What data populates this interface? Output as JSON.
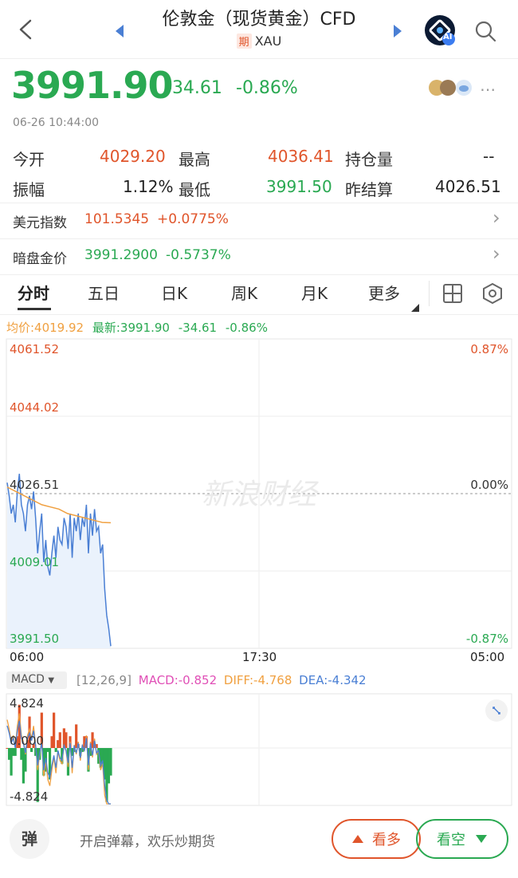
{
  "header": {
    "title": "伦敦金（现货黄金）CFD",
    "badge": "期",
    "symbol": "XAU",
    "ai_label": "AI"
  },
  "quote": {
    "price": "3991.90",
    "change": "-34.61",
    "change_pct": "-0.86%",
    "time": "06-26 10:44:00"
  },
  "stats": {
    "open_label": "今开",
    "open": "4029.20",
    "high_label": "最高",
    "high": "4036.41",
    "oi_label": "持仓量",
    "oi": "--",
    "amp_label": "振幅",
    "amp": "1.12%",
    "low_label": "最低",
    "low": "3991.50",
    "settle_label": "昨结算",
    "settle": "4026.51"
  },
  "related": [
    {
      "label": "美元指数",
      "value": "101.5345",
      "change": "+0.0775%"
    },
    {
      "label": "暗盘金价",
      "value": "3991.2900",
      "change": "-0.5737%"
    }
  ],
  "tabs": [
    "分时",
    "五日",
    "日K",
    "周K",
    "月K",
    "更多"
  ],
  "chart_legend": {
    "avg": "均价:4019.92",
    "latest": "最新:3991.90",
    "chg": "-34.61",
    "pct": "-0.86%"
  },
  "watermark": "新浪财经",
  "colors": {
    "up": "#e0552b",
    "down": "#2aa952",
    "line": "#4a7fd4",
    "avg": "#f0a040",
    "macd_pink": "#e04fb6",
    "diff": "#f0a040",
    "dea": "#4a7fd4"
  },
  "chart_data": [
    {
      "type": "line",
      "x_ticks": [
        "06:00",
        "17:30",
        "05:00"
      ],
      "y_ticks_left": [
        "4061.52",
        "4044.02",
        "4026.51",
        "4009.01",
        "3991.50"
      ],
      "y_ticks_right": [
        "0.87%",
        "",
        "0.00%",
        "",
        "-0.87%"
      ],
      "ylim": [
        3991.5,
        4061.52
      ],
      "series": [
        {
          "values": [
            4029,
            4026,
            4022,
            4024,
            4020,
            4027,
            4031,
            4024,
            4022,
            4018,
            4024,
            4026,
            4023,
            4027,
            4021,
            4013,
            4018,
            4022,
            4011,
            4016,
            4010,
            4008,
            4013,
            4017,
            4012,
            4019,
            4016,
            4015,
            4021,
            4019,
            4014,
            4022,
            4012,
            4021,
            4018,
            4022,
            4016,
            4021,
            4019,
            4024,
            4013,
            4022,
            4017,
            4023,
            4018,
            4019,
            4013,
            4015,
            4005,
            3999,
            3996,
            3992
          ]
        },
        {
          "name": "均价",
          "values": [
            4028,
            4027,
            4026,
            4025,
            4024,
            4023.5,
            4023,
            4022,
            4021.5,
            4021,
            4020.5,
            4020,
            4019.92
          ]
        }
      ]
    },
    {
      "type": "bar",
      "title": "MACD",
      "params": "[12,26,9]",
      "macd": "MACD:-0.852",
      "diff": "DIFF:-4.768",
      "dea": "DEA:-4.342",
      "y_ticks": [
        "4.824",
        "0.000",
        "-4.824"
      ],
      "ylim": [
        -4.824,
        4.824
      ]
    }
  ],
  "bottom": {
    "danmu_label": "开启弹幕，欢乐炒期货",
    "danmu_icon": "弹",
    "bull": "看多",
    "bear": "看空"
  }
}
